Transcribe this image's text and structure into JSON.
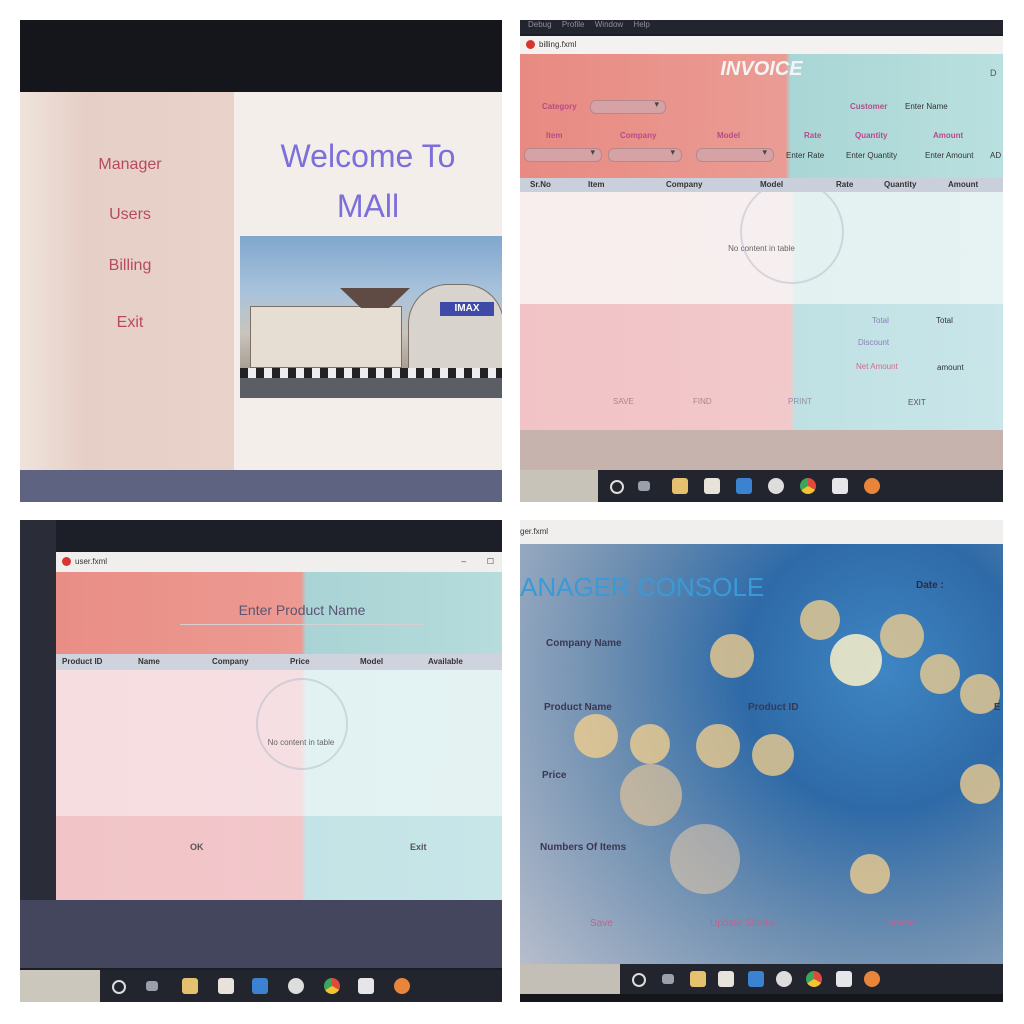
{
  "panel1": {
    "menu": [
      "Manager",
      "Users",
      "Billing",
      "Exit"
    ],
    "welcome_line1": "Welcome To",
    "welcome_line2": "MAll",
    "photo_sign": "IMAX"
  },
  "panel2": {
    "menubar": [
      "Debug",
      "Profile",
      "Window",
      "Help"
    ],
    "window_title": "billing.fxml",
    "heading": "INVOICE",
    "heading_right": "D",
    "category_label": "Category",
    "customer_label": "Customer",
    "customer_placeholder": "Enter Name",
    "row_labels": {
      "item": "Item",
      "company": "Company",
      "model": "Model",
      "rate": "Rate",
      "quantity": "Quantity",
      "amount": "Amount"
    },
    "rate_placeholder": "Enter Rate",
    "quantity_placeholder": "Enter Quantity",
    "amount_placeholder": "Enter Amount",
    "add_partial": "AD",
    "table_columns": [
      "Sr.No",
      "Item",
      "Company",
      "Model",
      "Rate",
      "Quantity",
      "Amount"
    ],
    "table_empty": "No content in table",
    "total_label": "Total",
    "total_value": "Total",
    "discount_label": "Discount",
    "net_amount_label": "Net Amount",
    "net_amount_value": "amount",
    "buttons": [
      "SAVE",
      "FIND",
      "PRINT",
      "EXIT"
    ]
  },
  "panel3": {
    "window_title": "user.fxml",
    "search_placeholder": "Enter Product Name",
    "table_columns": [
      "Product ID",
      "Name",
      "Company",
      "Price",
      "Model",
      "Available"
    ],
    "table_empty": "No content in table",
    "buttons": [
      "OK",
      "Exit"
    ]
  },
  "panel4": {
    "window_title": "ger.fxml",
    "heading": "ANAGER CONSOLE",
    "date_label": "Date :",
    "company_label": "Company Name",
    "product_name_label": "Product Name",
    "product_id_label": "Product ID",
    "right_partial": "E",
    "price_label": "Price",
    "items_label": "Numbers Of Items",
    "buttons": [
      "Save",
      "Update Stocks",
      "Delete"
    ]
  },
  "colors": {
    "accent_pink": "#b84a5e",
    "title_purple": "#7c6fd9",
    "salmon": "#e98e86",
    "teal": "#a9d6d6",
    "taskbar": "#23252e"
  },
  "taskbar_icons": [
    "cortana-circle-icon",
    "task-view-icon",
    "file-explorer-icon",
    "store-icon",
    "mail-icon",
    "media-icon",
    "chrome-icon",
    "package-icon",
    "app-icon"
  ]
}
